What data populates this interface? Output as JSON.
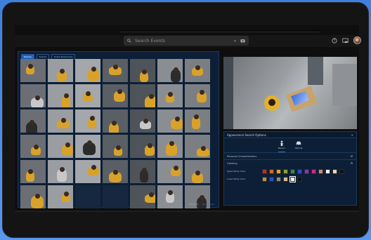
{
  "search": {
    "placeholder": "Search Events"
  },
  "left_panel": {
    "tabs": [
      {
        "label": "Results"
      },
      {
        "label": "Events"
      },
      {
        "label": "Event Bookmarks"
      }
    ],
    "link": "···",
    "footer": {
      "results": "RESULTS",
      "link": "Show more"
    }
  },
  "appearance_search": {
    "title": "Appearance Search Options",
    "object_types": [
      {
        "label": "Person",
        "icon": "person-icon"
      },
      {
        "label": "Vehicle",
        "icon": "vehicle-icon"
      }
    ],
    "sections": [
      {
        "label": "Personal Characteristics"
      },
      {
        "label": "Clothing"
      }
    ],
    "upper_body_label": "Upper Body Color",
    "lower_body_label": "Lower Body Color",
    "upper_body_colors": [
      "#c9282e",
      "#d4692a",
      "#e6a229",
      "#8fa12b",
      "#2a8f4a",
      "#2a4fc7",
      "#7a3ac7",
      "#c92a8a",
      "#c98a7a",
      "#f3f3f3",
      "#e8d8b8",
      "#111111"
    ],
    "lower_body_colors": [
      "#b8934c",
      "#2a4fc7",
      "#8a8a8a",
      "#d8b98a",
      "#f3f3f3",
      "#111111"
    ],
    "lower_body_selected_index": 4
  },
  "thumbnails": {
    "count_filled": 43,
    "empty_indices": [
      37,
      38,
      44,
      45,
      46,
      47,
      48,
      49,
      50,
      51,
      52,
      53,
      54,
      55
    ]
  }
}
